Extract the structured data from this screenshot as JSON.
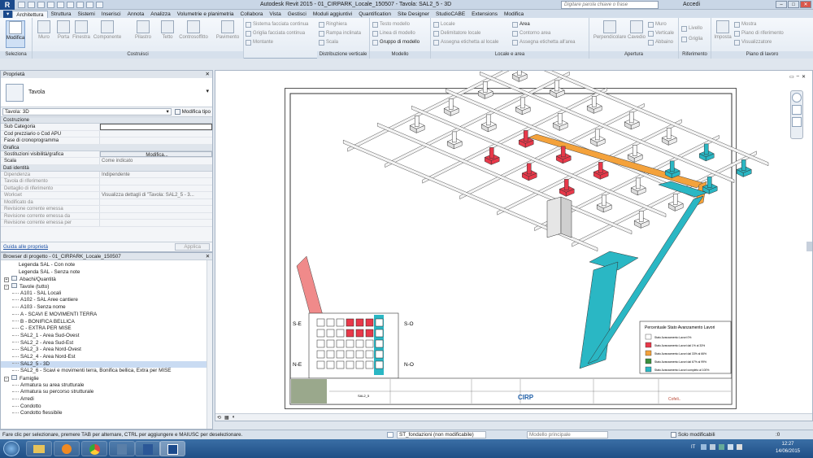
{
  "app": {
    "title": "Autodesk Revit 2015 -    01_CIRPARK_Locale_150507 - Tavola: SAL2_5 - 3D",
    "search_placeholder": "Digitare parola chiave o frase",
    "account": "Accedi"
  },
  "ribbon": {
    "tabs": [
      "Architettura",
      "Struttura",
      "Sistemi",
      "Inserisci",
      "Annota",
      "Analizza",
      "Volumetrie e planimetria",
      "Collabora",
      "Vista",
      "Gestisci",
      "Moduli aggiuntivi",
      "Quantification",
      "Site Designer",
      "StudioCABE",
      "Extensions",
      "Modifica"
    ],
    "active_tab": "Architettura",
    "select_buttons": [
      "Modifica"
    ],
    "build_buttons": [
      "Muro",
      "Porta",
      "Finestra",
      "Componente",
      "Pilastro",
      "Tetto",
      "Controsoffitto",
      "Pavimento"
    ],
    "curtain_items": [
      "Sistema facciata continua",
      "Griglia facciata continua",
      "Montante"
    ],
    "circulation_items": [
      "Ringhiera",
      "Rampa inclinata",
      "Scala"
    ],
    "model_items": [
      "Testo modello",
      "Linea di modello",
      "Gruppo di modello"
    ],
    "room_items": [
      "Locale",
      "Delimitatore locale",
      "Assegna etichetta al locale",
      "Area",
      "Contorno area",
      "Assegna etichetta all'area"
    ],
    "opening_items": [
      "Perpendicolare",
      "Cavedio",
      "Muro",
      "Verticale",
      "Abbaino"
    ],
    "datum_items": [
      "Livello",
      "Griglia"
    ],
    "workplane_items": [
      "Imposta",
      "Mostra",
      "Piano di riferimento",
      "Visualizzatore"
    ],
    "panels": [
      "Seleziona",
      "Costruisci",
      "Distribuzione verticale",
      "Modello",
      "Locale e area",
      "Apertura",
      "Riferimento",
      "Piano di lavoro"
    ]
  },
  "properties": {
    "header": "Proprietà",
    "type_name": "Tavola",
    "selector": "Tavola: 3D",
    "edit_type": "Modifica tipo",
    "sections": [
      {
        "name": "Costruzione",
        "rows": [
          {
            "k": "Sub Categoria",
            "v": ""
          },
          {
            "k": "Cod prezziario o Cod APU",
            "v": ""
          },
          {
            "k": "Fase di cronoprogramma",
            "v": ""
          }
        ]
      },
      {
        "name": "Grafica",
        "rows": [
          {
            "k": "Sostituzioni visibilità/grafica",
            "v": "Modifica..."
          },
          {
            "k": "Scala",
            "v": "Come indicato"
          }
        ]
      },
      {
        "name": "Dati identità",
        "rows": [
          {
            "k": "Dipendenza",
            "v": "Indipendente"
          },
          {
            "k": "Tavola di riferimento",
            "v": ""
          },
          {
            "k": "Dettaglio di riferimento",
            "v": ""
          },
          {
            "k": "Workset",
            "v": "Visualizza dettagli di \"Tavola: SAL2_5 - 3..."
          },
          {
            "k": "Modificato da",
            "v": ""
          },
          {
            "k": "Revisione corrente emessa",
            "v": ""
          },
          {
            "k": "Revisione corrente emessa da",
            "v": ""
          },
          {
            "k": "Revisione corrente emessa per",
            "v": ""
          }
        ]
      }
    ],
    "help_link": "Guida alle proprietà",
    "apply": "Applica"
  },
  "browser": {
    "title": "Browser di progetto - 01_CIRPARK_Locale_150507",
    "items": [
      {
        "label": "Legenda SAL - Con note",
        "level": 3
      },
      {
        "label": "Legenda SAL - Senza note",
        "level": 3
      },
      {
        "label": "Abachi/Quantità",
        "level": 1,
        "toggle": "+"
      },
      {
        "label": "Tavole (tutto)",
        "level": 1,
        "toggle": "−"
      },
      {
        "label": "A101 - SAL Locali",
        "level": 2
      },
      {
        "label": "A102 - SAL Aree cantiere",
        "level": 2
      },
      {
        "label": "A103 - Senza nome",
        "level": 2
      },
      {
        "label": "A - SCAVI E MOVIMENTI TERRA",
        "level": 2
      },
      {
        "label": "B - BONIFICA BELLICA",
        "level": 2
      },
      {
        "label": "C - EXTRA PER MISE",
        "level": 2
      },
      {
        "label": "SAL2_1 - Area Sud-Ovest",
        "level": 2
      },
      {
        "label": "SAL2_2 - Area Sud-Est",
        "level": 2
      },
      {
        "label": "SAL2_3 - Area Nord-Ovest",
        "level": 2
      },
      {
        "label": "SAL2_4 - Area Nord-Est",
        "level": 2
      },
      {
        "label": "SAL2_5 - 3D",
        "level": 2,
        "selected": true
      },
      {
        "label": "SAL2_6 - Scavi e movimenti terra, Bonifica bellica, Extra per MISE",
        "level": 2
      },
      {
        "label": "Famiglie",
        "level": 1,
        "toggle": "−"
      },
      {
        "label": "Armatura su area strutturale",
        "level": 2
      },
      {
        "label": "Armatura su percorso strutturale",
        "level": 2
      },
      {
        "label": "Arredi",
        "level": 2
      },
      {
        "label": "Condotto",
        "level": 2
      },
      {
        "label": "Condotto flessibile",
        "level": 2
      }
    ]
  },
  "sheet": {
    "compass": {
      "se": "S-E",
      "so": "S-O",
      "ne": "N-E",
      "no": "N-O"
    },
    "legend": {
      "title": "Percentuale Stato Avanzamento Lavori",
      "rows": [
        {
          "label": "Stato Avanzamento Lavori 0%",
          "color": "#ffffff"
        },
        {
          "label": "Stato Avanzamento Lavori dal 1% al 33%",
          "color": "#e8394a"
        },
        {
          "label": "Stato Avanzamento Lavori dal 33% al 66%",
          "color": "#f4a23b"
        },
        {
          "label": "Stato Avanzamento Lavori dal 67% al 99%",
          "color": "#3a8e3e"
        },
        {
          "label": "Stato Avanzamento Lavori completo al 100%",
          "color": "#2ab7c4"
        }
      ]
    },
    "titleblock": {
      "sheet_no": "SAL2_5",
      "logo1": "CIRP",
      "logo2": "Cofeli.."
    }
  },
  "status": {
    "hint": "Fare clic per selezionare, premere TAB per alternare, CTRL per aggiungere e MAIUSC per deselezionare.",
    "workset": "ST_fondazioni (non modificabile)",
    "model": "Modello principale",
    "editable_only": "Solo modificabili",
    "zero": ":0"
  },
  "canvas": {
    "scale_zero": "0"
  },
  "taskbar": {
    "lang": "IT",
    "time": "12:27",
    "date": "14/06/2015"
  },
  "colors": {
    "red": "#e8394a",
    "cyan": "#2ab7c4",
    "orange": "#f4a23b",
    "pink": "#f08a8a"
  }
}
